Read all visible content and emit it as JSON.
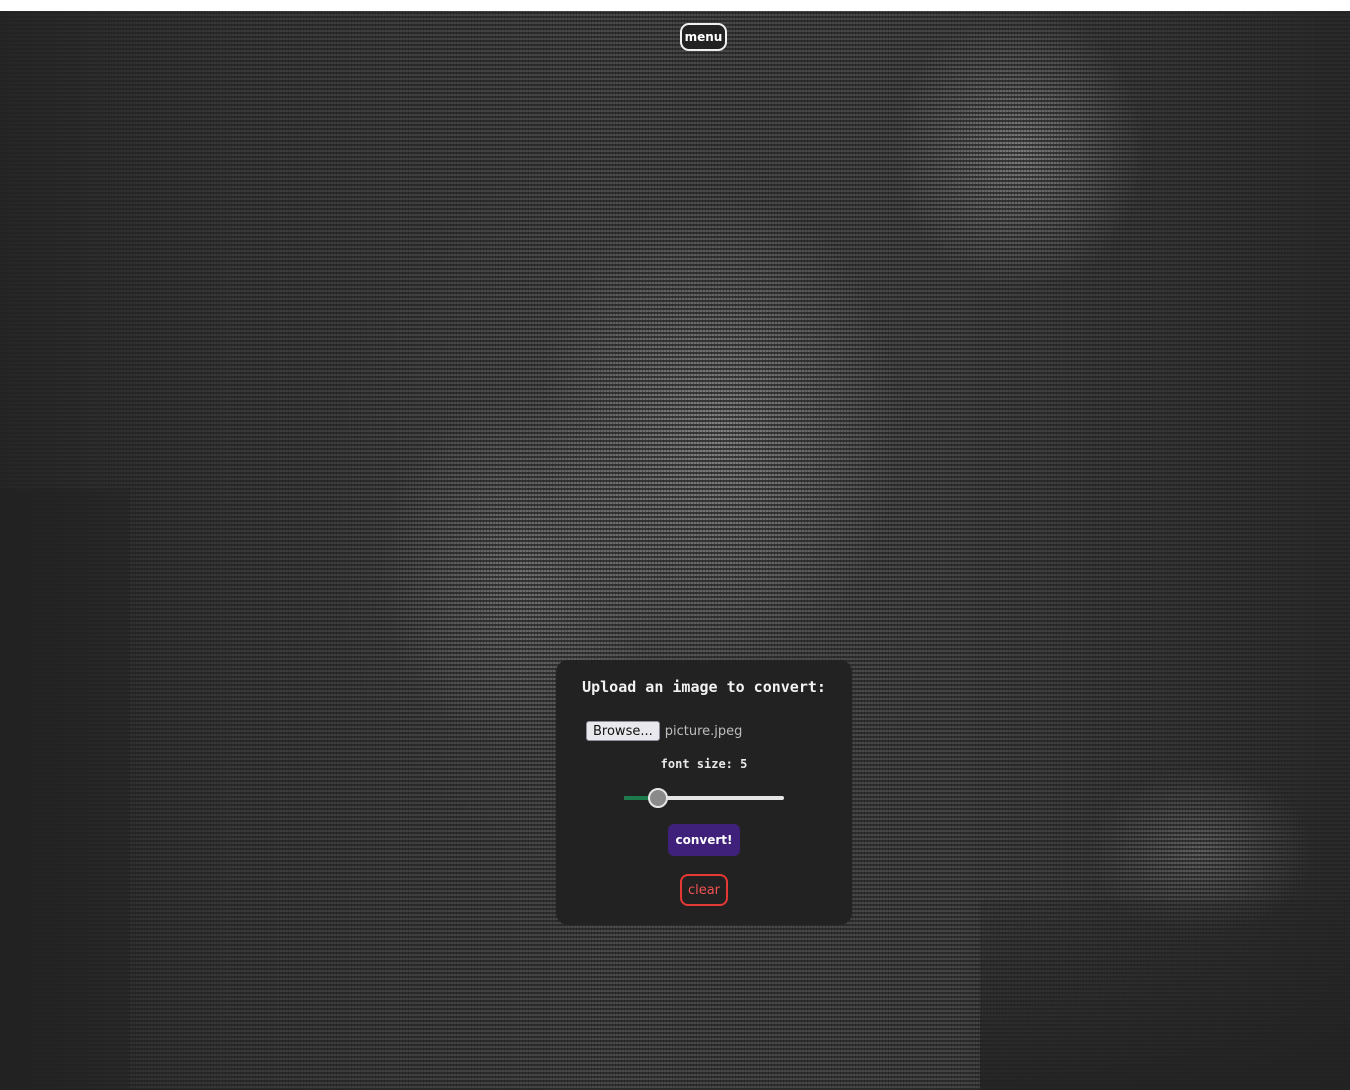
{
  "menu": {
    "label": "menu"
  },
  "upload_panel": {
    "title": "Upload an image to convert:",
    "browse_label": "Browse...",
    "file_name": "picture.jpeg",
    "font_size_label": "font size: 5",
    "font_size": {
      "value": 5,
      "fill_fraction": 0.21
    },
    "convert_label": "convert!",
    "clear_label": "clear"
  },
  "colors": {
    "background": "#222222",
    "convert_button": "#3f207a",
    "clear_button": "#e53935",
    "slider_fill": "#1d7a4d"
  }
}
